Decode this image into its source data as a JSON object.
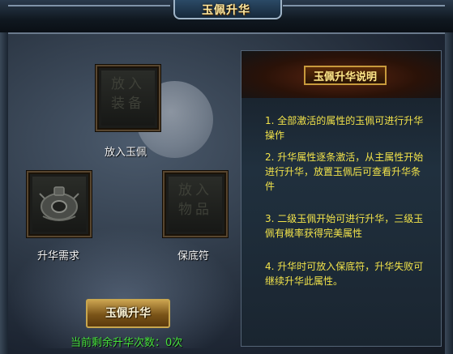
{
  "window": {
    "title": "玉佩升华"
  },
  "slots": {
    "jade": {
      "label": "放入玉佩",
      "placeholder": "放入装备"
    },
    "requirement": {
      "label": "升华需求"
    },
    "protect": {
      "label": "保底符",
      "placeholder": "放入物品"
    }
  },
  "actions": {
    "upgrade_label": "玉佩升华"
  },
  "status": {
    "remaining_text": "当前剩余升华次数：0次"
  },
  "help": {
    "title": "玉佩升华说明",
    "notes": [
      "1. 全部激活的属性的玉佩可进行升华操作",
      "2. 升华属性逐条激活，从主属性开始进行升华，放置玉佩后可查看升华条件",
      "3. 二级玉佩开始可进行升华，三级玉佩有概率获得完美属性",
      "4. 升华时可放入保底符，升华失败可继续升华此属性。"
    ]
  },
  "colors": {
    "title_gold": "#ffe9a0",
    "note_yellow": "#f2e34a",
    "status_green": "#46e03c"
  }
}
